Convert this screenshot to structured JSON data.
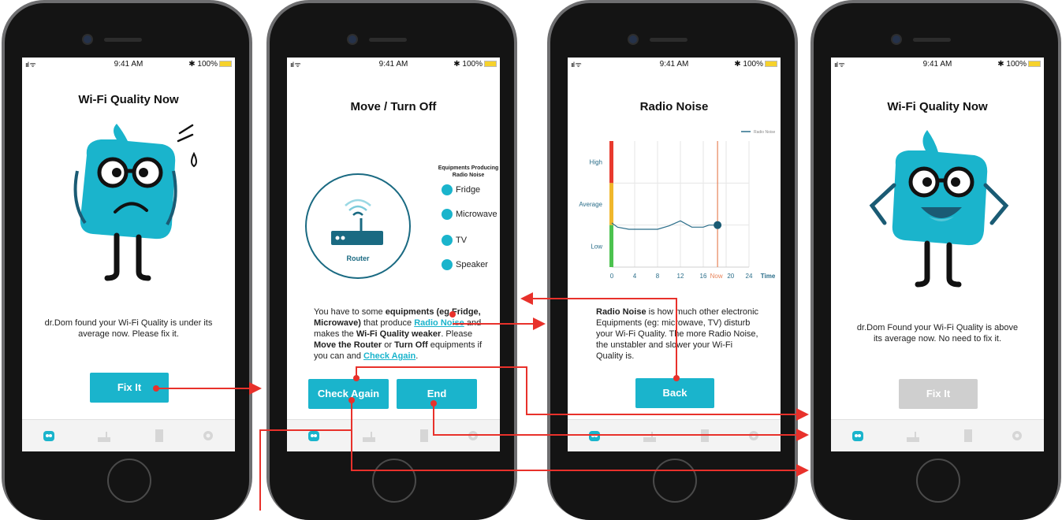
{
  "status_bar": {
    "signal": "ııl ᯤ",
    "time": "9:41 AM",
    "battery": "✱ 100%"
  },
  "screen1": {
    "title": "Wi-Fi Quality Now",
    "message": "dr.Dom found your Wi-Fi Quality is under its average now. Please fix it.",
    "button": "Fix It"
  },
  "screen2": {
    "title": "Move  / Turn Off",
    "router_label": "Router",
    "equip_heading": "Equipments Producing Radio Noise",
    "equipment": [
      "Fridge",
      "Microwave",
      "TV",
      "Speaker"
    ],
    "para": {
      "p1": "You have to some ",
      "b1": "equipments (eg Fridge, Microwave)",
      "p2": " that produce ",
      "link1": "Radio Noise",
      "p3": " and makes the ",
      "b2": "Wi-Fi Quality weaker",
      "p4": ". Please ",
      "b3": "Move the Router",
      "p5": " or ",
      "b4": "Turn Off",
      "p6": " equipments if you can and ",
      "link2": "Check Again",
      "p7": "."
    },
    "buttons": {
      "check_again": "Check Again",
      "end": "End"
    }
  },
  "screen3": {
    "title": "Radio Noise",
    "legend": "Radio Noise",
    "para": {
      "b1": "Radio Noise",
      "p1": " is how much other electronic Equipments  (eg: microwave, TV) disturb your Wi-Fi Quality. The more Radio Noise, the unstabler and slower your Wi-Fi Quality is."
    },
    "button": "Back"
  },
  "screen4": {
    "title": "Wi-Fi Quality Now",
    "message": "dr.Dom Found your Wi-Fi Quality is above its average now. No need to fix it.",
    "button": "Fix It"
  },
  "chart_data": {
    "type": "line",
    "xlabel": "Time",
    "ylabel": "",
    "x_ticks": [
      "0",
      "4",
      "8",
      "12",
      "16",
      "Now",
      "20",
      "24"
    ],
    "y_ticks": [
      "Low",
      "Average",
      "High"
    ],
    "xlim": [
      0,
      24
    ],
    "series": [
      {
        "name": "Radio Noise",
        "x": [
          0,
          1,
          3,
          5,
          8,
          10,
          12,
          14,
          16,
          17,
          18.5
        ],
        "y": [
          1.05,
          0.95,
          0.9,
          0.9,
          0.9,
          0.98,
          1.1,
          0.95,
          0.95,
          1.0,
          1.0
        ]
      }
    ],
    "grid": true,
    "legend": "top-right",
    "colors": {
      "line": "#2b6e8a",
      "now_marker": "#e8845a",
      "high": "#e83a2e",
      "average": "#f0b72c",
      "low": "#4cc24f"
    }
  },
  "colors": {
    "accent": "#1ab4cc",
    "arrow": "#e8312b",
    "disabled": "#cfcfcf"
  }
}
